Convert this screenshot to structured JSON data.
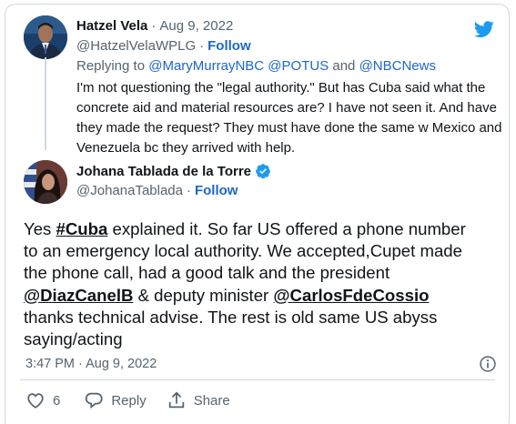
{
  "reply_tweet": {
    "display_name": "Hatzel Vela",
    "date": "Aug 9, 2022",
    "handle": "@HatzelVelaWPLG",
    "follow_label": "Follow",
    "replying_prefix": "Replying to",
    "mention_1": "@MaryMurrayNBC",
    "mention_2": "@POTUS",
    "and_word": "and",
    "mention_3": "@NBCNews",
    "text_lines": [
      "I'm not questioning the \"legal authority.\" But has Cuba said what the",
      "concrete aid and material resources are? I have not seen it. And have",
      "they made the request? They must have done the same w Mexico and",
      "Venezuela bc they arrived with help."
    ]
  },
  "main_tweet": {
    "display_name": "Johana Tablada de la Torre",
    "handle": "@JohanaTablada",
    "follow_label": "Follow",
    "line1_pre": "Yes ",
    "hashtag": "#Cuba",
    "line1_post": " explained it. So far US offered a phone number",
    "line2": "to an emergency local authority. We accepted,Cupet made",
    "line3": "the phone call, had a good talk and the president",
    "mention_a": "@DiazCanelB",
    "line4_mid": " & deputy minister ",
    "mention_b": "@CarlosFdeCossio",
    "line5": "thanks technical advise. The rest is old same US abyss",
    "line6": "saying/acting",
    "timestamp": "3:47 PM · Aug 9, 2022"
  },
  "actions": {
    "like_count": "6",
    "reply_label": "Reply",
    "share_label": "Share"
  },
  "colors": {
    "twitter_blue": "#1d9bf0",
    "link_blue": "#1d67c9",
    "muted": "#536471",
    "border": "#cfd9de"
  }
}
